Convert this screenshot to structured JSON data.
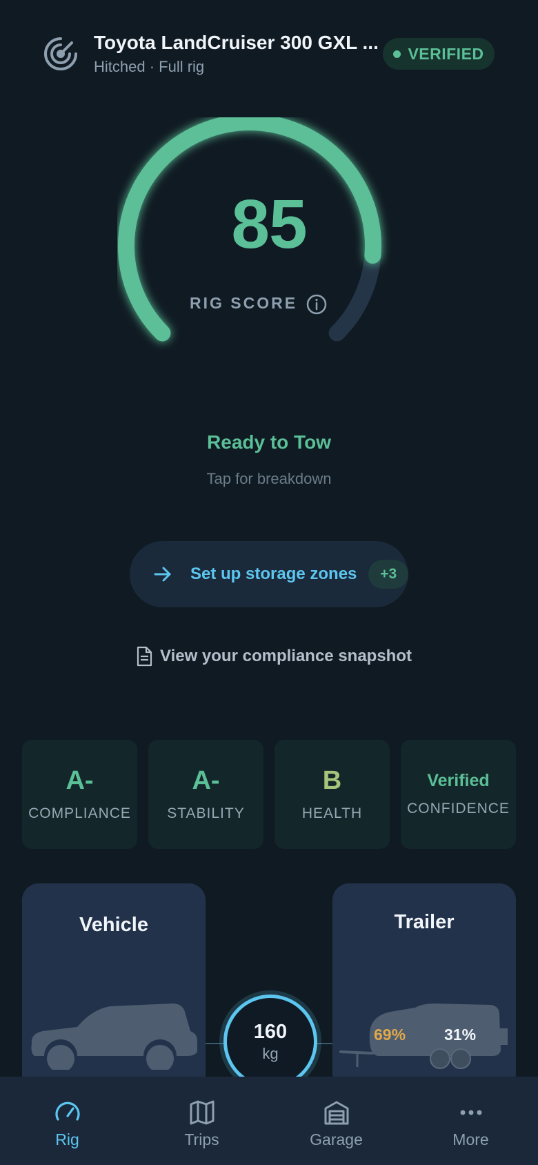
{
  "header": {
    "title": "Toyota LandCruiser 300 GXL ...",
    "subtitle": "Hitched · Full rig",
    "status_badge": "VERIFIED"
  },
  "score": {
    "value": "85",
    "fraction": 0.85,
    "label": "RIG SCORE",
    "status": "Ready to Tow",
    "hint": "Tap for breakdown"
  },
  "actions": {
    "storage_zones_label": "Set up storage zones",
    "storage_zones_badge": "+3",
    "compliance_link": "View your compliance snapshot"
  },
  "grades": [
    {
      "value": "A-",
      "label": "COMPLIANCE",
      "color": "#5bbf97"
    },
    {
      "value": "A-",
      "label": "STABILITY",
      "color": "#5bbf97"
    },
    {
      "value": "B",
      "label": "HEALTH",
      "color": "#a8c47a"
    },
    {
      "value": "Verified",
      "label": "CONFIDENCE",
      "color": "#5bbf97"
    }
  ],
  "rig": {
    "vehicle_title": "Vehicle",
    "trailer_title": "Trailer",
    "hitch_value": "160",
    "hitch_unit": "kg",
    "trailer_split_front": "69%",
    "trailer_split_rear": "31%"
  },
  "nav": [
    {
      "label": "Rig",
      "icon": "gauge-icon",
      "active": true
    },
    {
      "label": "Trips",
      "icon": "map-icon"
    },
    {
      "label": "Garage",
      "icon": "garage-icon"
    },
    {
      "label": "More",
      "icon": "more-dots-icon"
    }
  ],
  "colors": {
    "accent_green": "#5bbf97",
    "accent_blue": "#5cc6f0",
    "warning_amber": "#e2a84a",
    "background": "#101a22"
  }
}
